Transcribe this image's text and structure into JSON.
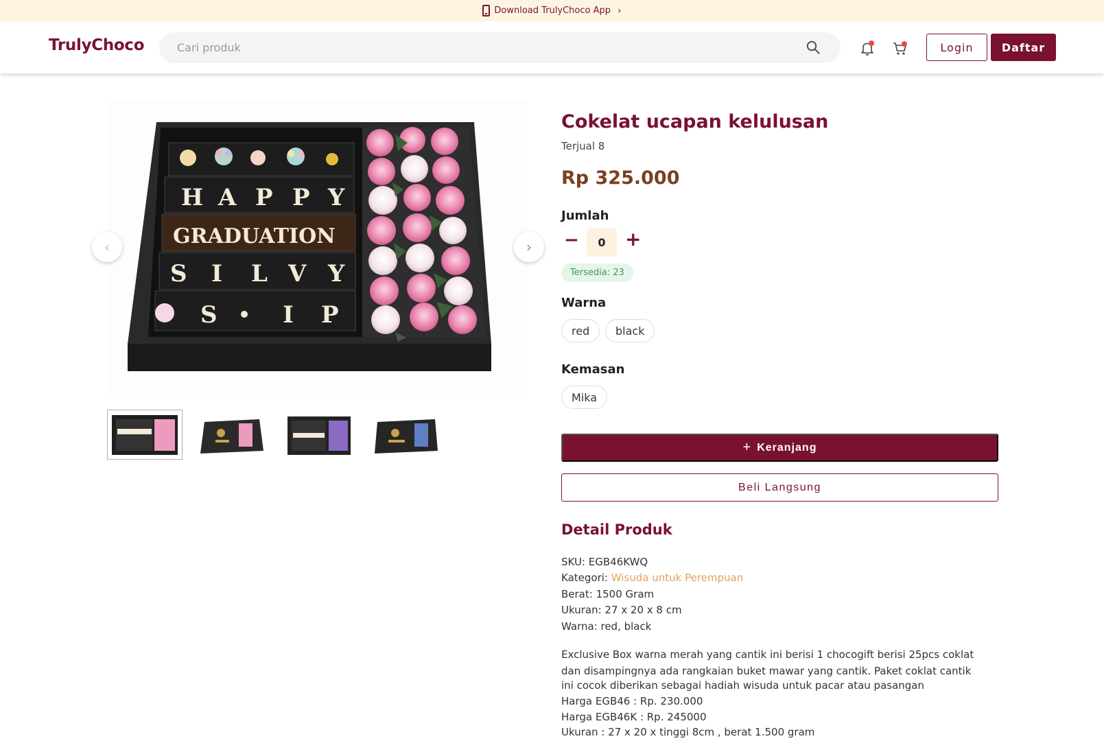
{
  "topbar": {
    "text": "Download TrulyChoco App"
  },
  "header": {
    "logo": "TrulyChoco",
    "search_placeholder": "Cari produk",
    "login": "Login",
    "register": "Daftar"
  },
  "product": {
    "title": "Cokelat ucapan kelulusan",
    "sold": "Terjual 8",
    "price": "Rp 325.000",
    "quantity_label": "Jumlah",
    "quantity": "0",
    "stock": "Tersedia: 23",
    "color_label": "Warna",
    "colors": [
      "red",
      "black"
    ],
    "packaging_label": "Kemasan",
    "packaging": [
      "Mika"
    ],
    "add_to_cart": "Keranjang",
    "buy_now": "Beli Langsung",
    "image_text": [
      "H",
      "A",
      "P",
      "P",
      "Y",
      "GRADUATION",
      "S",
      "I",
      "L",
      "V",
      "Y",
      "S",
      "I",
      "P"
    ]
  },
  "detail": {
    "title": "Detail Produk",
    "sku": "SKU: EGB46KWQ",
    "category_prefix": "Kategori: ",
    "category": "Wisuda untuk Perempuan",
    "weight": "Berat: 1500 Gram",
    "size": "Ukuran: 27 x 20 x 8 cm",
    "color": "Warna: red, black",
    "description": [
      "Exclusive Box warna merah yang cantik ini berisi 1 chocogift berisi 25pcs coklat",
      "dan disampingnya ada rangkaian buket mawar yang cantik. Paket coklat cantik",
      "ini cocok diberikan sebagai hadiah wisuda untuk pacar atau pasangan",
      "Harga EGB46 : Rp. 230.000",
      "Harga EGB46K : Rp. 245000",
      "Ukuran : 27 x 20 x tinggi 8cm , berat 1.500 gram"
    ]
  },
  "colors": {
    "brand": "#7a1131",
    "topbar_bg": "#fdf5e2",
    "price": "#7a4020",
    "stock_bg": "#e6f5ea",
    "stock_text": "#3a9b53",
    "link": "#e0a35a"
  },
  "icons": [
    "phone-icon",
    "chevron-right-icon",
    "search-icon",
    "bell-icon",
    "cart-icon",
    "chevron-left-icon",
    "minus-icon",
    "plus-icon"
  ]
}
